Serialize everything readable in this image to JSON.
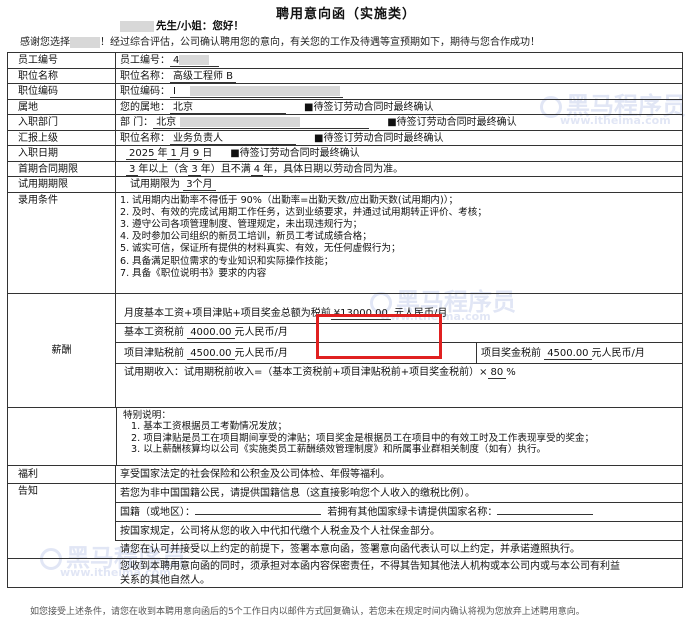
{
  "doc": {
    "title": "聘用意向函（实施类）",
    "greeting": "先生/小姐：您好！",
    "thanks_pre": "感谢您选择",
    "thanks_post": "！经过综合评估，公司确认聘用您的意向，有关您的工作及待遇等宣预期如下，期待与您合作成功！"
  },
  "rows": {
    "emp_id": {
      "label": "员工编号",
      "prefix": "员工编号：",
      "value": "4"
    },
    "position": {
      "label": "职位名称",
      "prefix": "职位名称：",
      "value": "高级工程师 B"
    },
    "position_code": {
      "label": "职位编码",
      "prefix": "职位编码：",
      "value": "I"
    },
    "location": {
      "label": "属地",
      "prefix": "您的属地：",
      "value": "北京",
      "note": "■待签订劳动合同时最终确认"
    },
    "dept": {
      "label": "入职部门",
      "prefix": "部    门：",
      "value": "北京",
      "note": "■待签订劳动合同时最终确认"
    },
    "report": {
      "label": "汇报上级",
      "prefix": "职位名称：",
      "value": "业务负责人",
      "note": "■待签订劳动合同时最终确认"
    },
    "start_date": {
      "label": "入职日期",
      "year": "2025",
      "y": "年",
      "month": "1",
      "m": "月",
      "day": "9",
      "d": "日",
      "note": "■待签订劳动合同时最终确认"
    },
    "contract": {
      "label": "首期合同期限",
      "min": "3",
      "t1": "年以上（含",
      "inc": "3",
      "t2": "年）且不满",
      "max": "4",
      "t3": "年，具体日期以劳动合同为准。"
    },
    "probation": {
      "label": "试用期期限",
      "prefix": "试用期限为",
      "value": "3个月"
    }
  },
  "conditions": {
    "label": "录用条件",
    "items": [
      {
        "n": "1.",
        "text": "试用期内出勤率不得低于 90%（出勤率=出勤天数/应出勤天数(试用期内)）；"
      },
      {
        "n": "2.",
        "text": "及时、有效的完成试用期工作任务，达到业绩要求，并通过试用期转正评价、考核；"
      },
      {
        "n": "3.",
        "text": "遵守公司各项管理制度、管理规定，未出现违规行为；"
      },
      {
        "n": "4.",
        "text": "及时参加公司组织的新员工培训，新员工考试成绩合格；"
      },
      {
        "n": "5.",
        "text": "诚实可信，保证所有提供的材料真实、有效，无任何虚假行为；"
      },
      {
        "n": "6.",
        "text": "具备满足职位需求的专业知识和实际操作技能；"
      },
      {
        "n": "7.",
        "text": "具备《职位说明书》要求的内容"
      }
    ]
  },
  "salary": {
    "label": "薪酬",
    "monthly_pre": "月度基本工资+项目津贴+项目奖金总额为税前",
    "monthly_val": "¥13000.00",
    "monthly_post": "元人民币/月",
    "base_pre": "基本工资税前",
    "base_val": "4000.00",
    "base_post": "元人民币/月",
    "allow_pre": "项目津贴税前",
    "allow_val": "4500.00",
    "allow_post": "元人民币/月",
    "bonus_pre": "项目奖金税前",
    "bonus_val": "4500.00",
    "bonus_post": "元人民币/月",
    "prob_pre": "试用期收入：试用期税前收入=（基本工资税前+项目津贴税前+项目奖金税前）×",
    "prob_val": "80",
    "prob_post": "%"
  },
  "special": {
    "title": "特别说明：",
    "lines": [
      "1.  基本工资根据员工考勤情况发放；",
      "2.  项目津贴是员工在项目期间享受的津贴；项目奖金是根据员工在项目中的有效工时及工作表现享受的奖金；",
      "3.  以上薪酬核算均以公司《实施类员工薪酬绩效管理制度》和所属事业群相关制度（如有）执行。"
    ]
  },
  "welfare": {
    "label": "福利",
    "text": "享受国家法定的社会保险和公积金及公司体检、年假等福利。"
  },
  "notice": {
    "label": "告知",
    "l1": "若您为非中国国籍公民，请提供国籍信息（这直接影响您个人收入的缴税比例）。",
    "l2a": "国籍（或地区）：",
    "l2b": "若拥有其他国家绿卡请提供国家名称：",
    "l3": "按国家规定，公司将从您的收入中代扣代缴个人税金及个人社保金部分。",
    "l4": "请您在认可并接受以上约定的前提下，签署本意向函，签署意向函代表认可以上约定，并承诺遵照执行。",
    "l5a": "您收到本聘用意向函的同时，须承担对本函内容保密责任，不得其告知其他法人机构或本公司内或与本公司有利益",
    "l5b": "关系的其他自然人。"
  },
  "footer": "如您接受上述条件，请您在收到本聘用意向函后的5个工作日内以邮件方式回复确认，若您未在规定时间内确认将视为您放弃上述聘用意向。",
  "watermark": {
    "brand": "黑马程序员",
    "url": "www.itheima.com"
  },
  "colors": {
    "highlight": "#e02020",
    "watermark": "#c9d2ee"
  }
}
